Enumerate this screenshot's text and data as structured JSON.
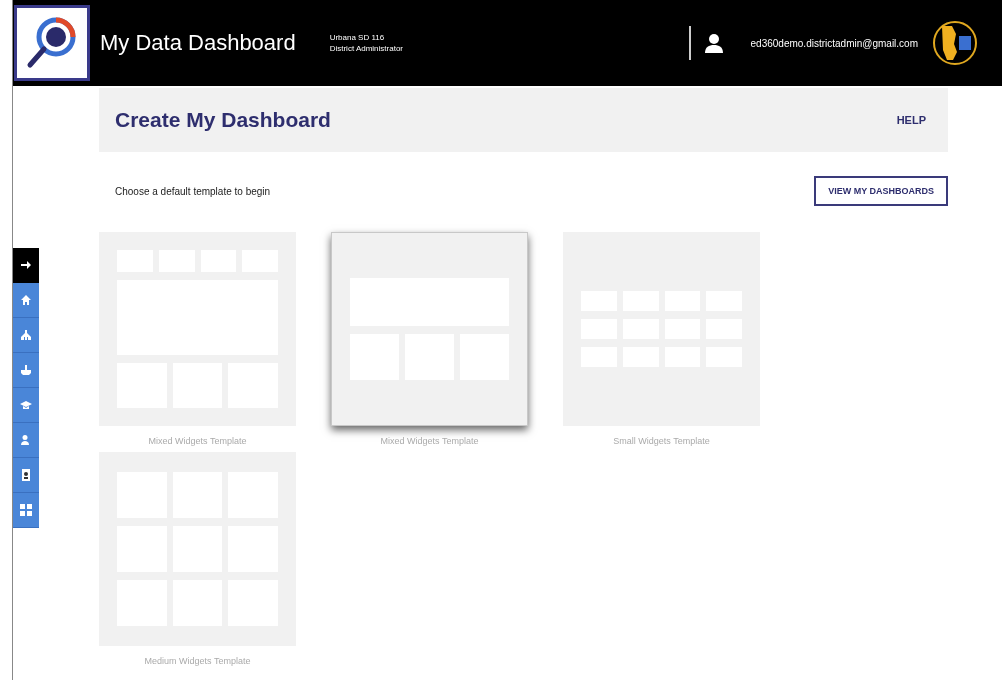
{
  "header": {
    "title": "My Data Dashboard",
    "district": "Urbana SD 116",
    "role": "District Administrator",
    "email": "ed360demo.districtadmin@gmail.com"
  },
  "sidebar": {
    "toggle": {
      "kind": "arrow"
    },
    "items": [
      {
        "kind": "home"
      },
      {
        "kind": "tree"
      },
      {
        "kind": "podium"
      },
      {
        "kind": "cap"
      },
      {
        "kind": "person"
      },
      {
        "kind": "badge"
      },
      {
        "kind": "widgets"
      }
    ]
  },
  "page": {
    "title": "Create My Dashboard",
    "help": "HELP",
    "hint": "Choose a default template to begin",
    "view_button": "VIEW MY DASHBOARDS"
  },
  "templates": [
    {
      "kind": "mixed-large",
      "label": "Mixed Widgets Template",
      "selected": false
    },
    {
      "kind": "mixed-wide",
      "label": "Mixed Widgets Template",
      "selected": true
    },
    {
      "kind": "small",
      "label": "Small Widgets Template",
      "selected": false
    },
    {
      "kind": "medium",
      "label": "Medium Widgets Template",
      "selected": false
    }
  ]
}
